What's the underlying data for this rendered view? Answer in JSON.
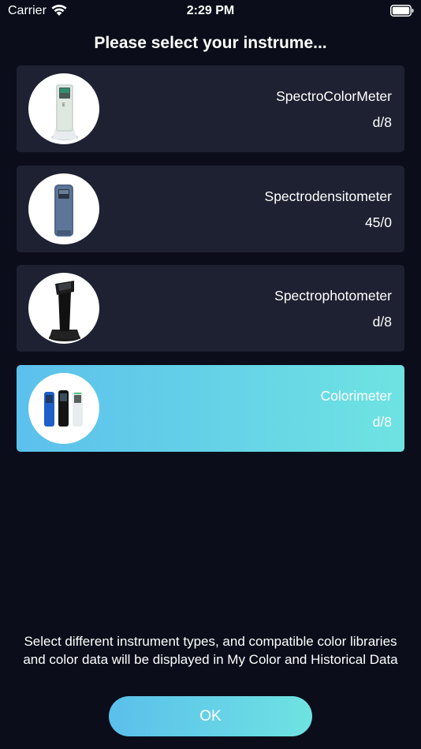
{
  "status_bar": {
    "carrier": "Carrier",
    "time": "2:29 PM",
    "wifi_icon": "wifi-icon",
    "battery_icon": "battery-icon"
  },
  "title": "Please select your instrume...",
  "instruments": [
    {
      "name": "SpectroColorMeter",
      "geometry": "d/8",
      "image": "spectrocolormeter-device-image",
      "selected": false
    },
    {
      "name": "Spectrodensitometer",
      "geometry": "45/0",
      "image": "spectrodensitometer-device-image",
      "selected": false
    },
    {
      "name": "Spectrophotometer",
      "geometry": "d/8",
      "image": "spectrophotometer-device-image",
      "selected": false
    },
    {
      "name": "Colorimeter",
      "geometry": "d/8",
      "image": "colorimeter-device-image",
      "selected": true
    }
  ],
  "hint": "Select different instrument types, and compatible color libraries and color data will be displayed in My Color and Historical Data",
  "ok_label": "OK",
  "colors": {
    "background": "#0b0e1a",
    "card": "#1e2131",
    "accent_start": "#5cc0ec",
    "accent_end": "#6ee3e2"
  }
}
